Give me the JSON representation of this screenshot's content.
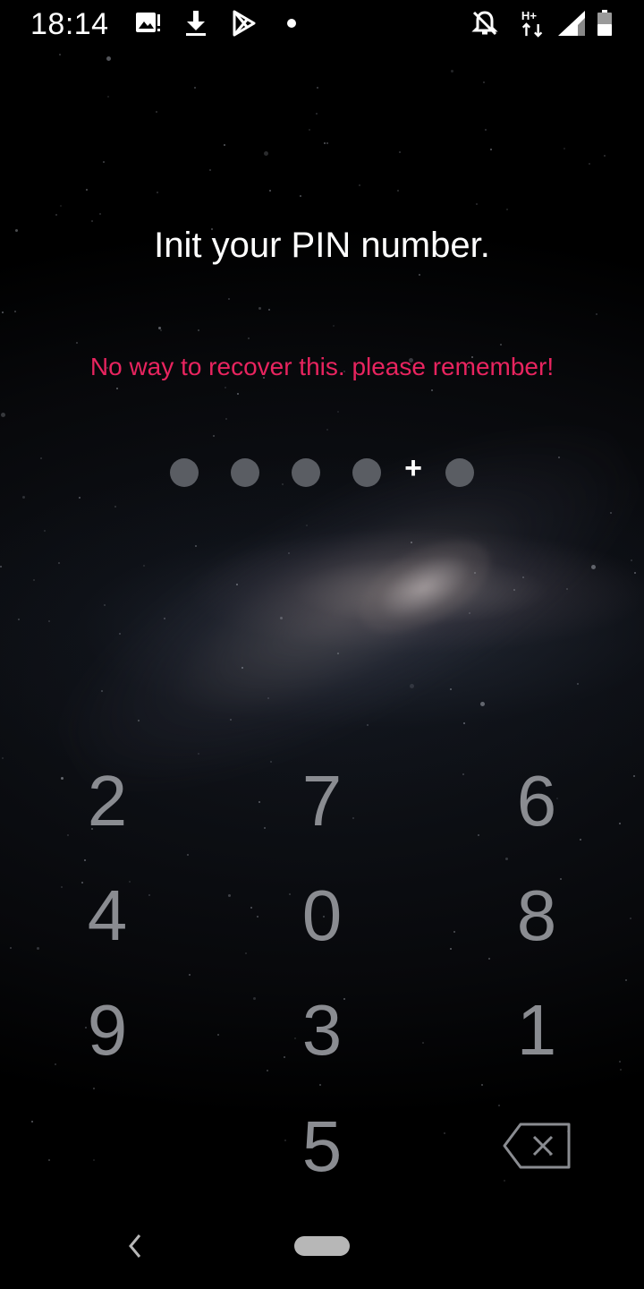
{
  "status_bar": {
    "time": "18:14",
    "left_icons": [
      "image-notification-icon",
      "download-icon",
      "play-store-icon",
      "dot-icon"
    ],
    "right_icons": [
      "notifications-off-icon",
      "hplus-data-icon",
      "signal-icon",
      "battery-icon"
    ],
    "data_label": "H+"
  },
  "screen": {
    "title": "Init your PIN number.",
    "warning": "No way to recover this. please remember!",
    "warning_color": "#e8245f"
  },
  "pin": {
    "entered": 5,
    "indicator": "+"
  },
  "keypad": {
    "keys": [
      "2",
      "7",
      "6",
      "4",
      "0",
      "8",
      "9",
      "3",
      "1",
      "5"
    ],
    "backspace_icon": "backspace-icon"
  },
  "nav_bar": {
    "back_icon": "back-chevron-icon",
    "home_icon": "home-pill-icon"
  }
}
